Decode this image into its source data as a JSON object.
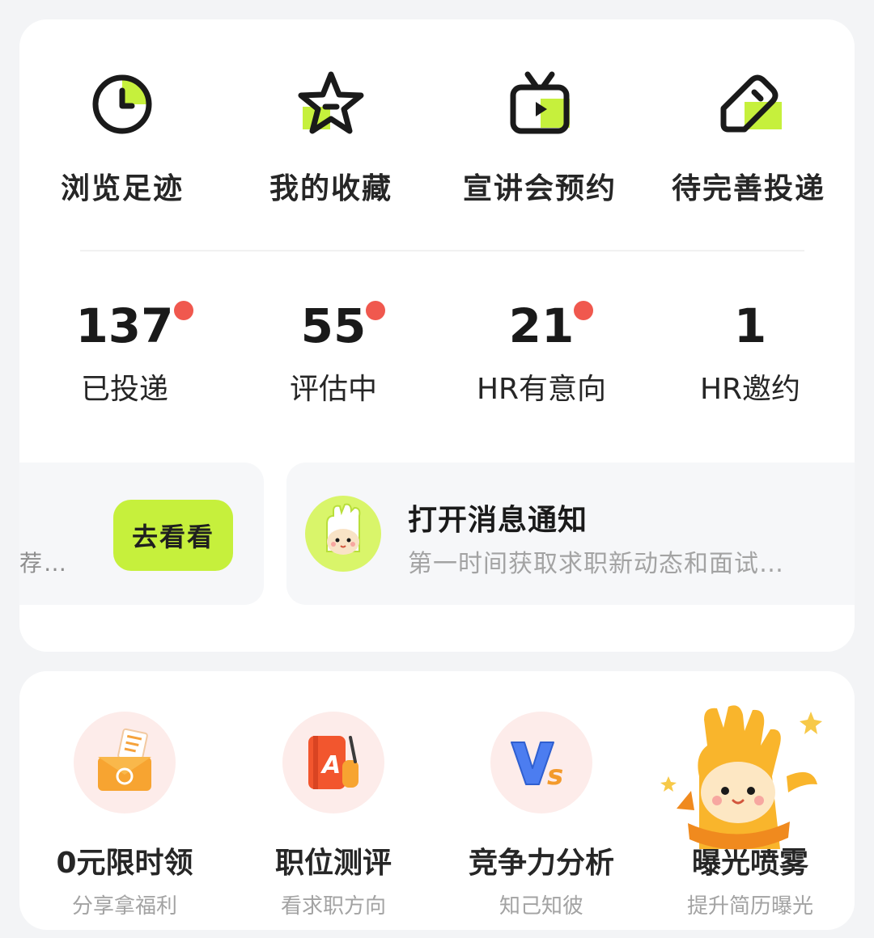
{
  "shortcuts": [
    {
      "label": "浏览足迹",
      "icon": "clock-icon"
    },
    {
      "label": "我的收藏",
      "icon": "star-icon"
    },
    {
      "label": "宣讲会预约",
      "icon": "tv-play-icon"
    },
    {
      "label": "待完善投递",
      "icon": "tag-edit-icon"
    }
  ],
  "stats": [
    {
      "value": "137",
      "label": "已投递",
      "has_dot": true
    },
    {
      "value": "55",
      "label": "评估中",
      "has_dot": true
    },
    {
      "value": "21",
      "label": "HR有意向",
      "has_dot": true
    },
    {
      "value": "1",
      "label": "HR邀约",
      "has_dot": false
    }
  ],
  "promo_left": {
    "truncated_text": "荐…",
    "button_label": "去看看"
  },
  "promo_right": {
    "title": "打开消息通知",
    "subtitle": "第一时间获取求职新动态和面试…"
  },
  "features": [
    {
      "title": "0元限时领",
      "subtitle": "分享拿福利",
      "icon": "gift-envelope-icon"
    },
    {
      "title": "职位测评",
      "subtitle": "看求职方向",
      "icon": "book-pen-icon"
    },
    {
      "title": "竞争力分析",
      "subtitle": "知己知彼",
      "icon": "vs-icon"
    },
    {
      "title": "曝光喷雾",
      "subtitle": "提升简历曝光",
      "icon": "mascot-icon"
    }
  ],
  "colors": {
    "accent": "#c6f03c",
    "badge_dot": "#f0584e",
    "card_bg": "#ffffff",
    "page_bg": "#f3f4f6"
  }
}
